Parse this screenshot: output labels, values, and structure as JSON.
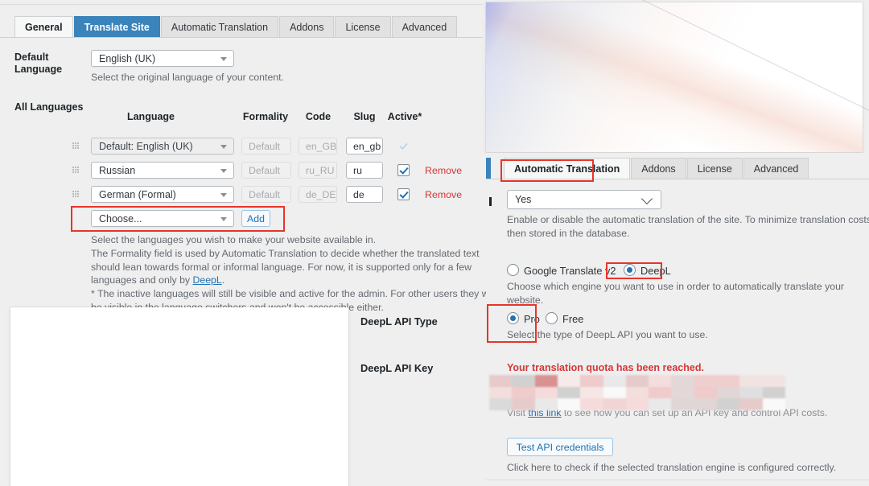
{
  "left_panel": {
    "tabs": [
      {
        "label": "General",
        "state": "active-white"
      },
      {
        "label": "Translate Site",
        "state": "active-blue"
      },
      {
        "label": "Automatic Translation",
        "state": "idle"
      },
      {
        "label": "Addons",
        "state": "idle"
      },
      {
        "label": "License",
        "state": "idle"
      },
      {
        "label": "Advanced",
        "state": "idle"
      }
    ],
    "default_language": {
      "label_line1": "Default",
      "label_line2": "Language",
      "value": "English (UK)",
      "hint": "Select the original language of your content."
    },
    "all_languages": {
      "section_label": "All Languages",
      "columns": [
        "Language",
        "Formality",
        "Code",
        "Slug",
        "Active*"
      ],
      "rows": [
        {
          "language": "Default: English (UK)",
          "formality": "Default",
          "code": "en_GB",
          "slug": "en_gb",
          "active": true,
          "active_style": "plain-tick",
          "remove": "",
          "language_disabled": true
        },
        {
          "language": "Russian",
          "formality": "Default",
          "code": "ru_RU",
          "slug": "ru",
          "active": true,
          "active_style": "checkbox",
          "remove": "Remove",
          "language_disabled": false
        },
        {
          "language": "German (Formal)",
          "formality": "Default",
          "code": "de_DE_",
          "slug": "de",
          "active": true,
          "active_style": "checkbox",
          "remove": "Remove",
          "language_disabled": false
        }
      ],
      "add_row": {
        "choose_value": "Choose...",
        "add_label": "Add"
      }
    },
    "description": {
      "line1": "Select the languages you wish to make your website available in.",
      "line2a": "The Formality field is used by Automatic Translation to decide whether the translated text should lean towards formal or informal language. For now, it is supported only for a few languages and only by ",
      "line2_link": "DeepL",
      "line2b": ".",
      "line3": "* The inactive languages will still be visible and active for the admin. For other users they won't be visible in the language switchers and won't be accessible either."
    }
  },
  "right_panel": {
    "tabs": [
      {
        "label": "Automatic Translation",
        "state": "active-white"
      },
      {
        "label": "Addons",
        "state": "idle"
      },
      {
        "label": "License",
        "state": "idle"
      },
      {
        "label": "Advanced",
        "state": "idle"
      }
    ],
    "enable_select": {
      "value": "Yes",
      "hint_line1": "Enable or disable the automatic translation of the site. To minimize translation costs, eac",
      "hint_line2": "then stored in the database."
    },
    "engine": {
      "options": [
        {
          "label": "Google Translate v2",
          "selected": false
        },
        {
          "label": "DeepL",
          "selected": true
        }
      ],
      "hint": "Choose which engine you want to use in order to automatically translate your website."
    },
    "api_type": {
      "row_label": "DeepL API Type",
      "options": [
        {
          "label": "Pro",
          "selected": true
        },
        {
          "label": "Free",
          "selected": false
        }
      ],
      "hint": "Select the type of DeepL API you want to use."
    },
    "api_key": {
      "row_label": "DeepL API Key",
      "error": "Your translation quota has been reached.",
      "redacted": true,
      "visit_pre": "Visit ",
      "visit_link": "this link",
      "visit_post": " to see how you can set up an API key and control API costs."
    },
    "test_credentials": {
      "button_label": "Test API credentials",
      "hint": "Click here to check if the selected translation engine is configured correctly."
    }
  },
  "colors": {
    "accent_blue": "#3a83bb",
    "link_blue": "#2271b1",
    "danger_red": "#d63638",
    "annotation_red": "#e8342a",
    "panel_bg": "#efefef"
  }
}
